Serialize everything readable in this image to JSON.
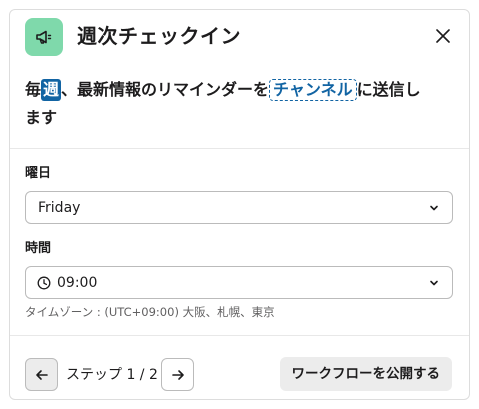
{
  "dialog": {
    "title": "週次チェックイン",
    "summary": {
      "part1": "毎",
      "week_token": "週",
      "part2": "、最新情報のリマインダーを",
      "channel_token": "チャンネル",
      "part3": "に送信し",
      "part4": "ます"
    }
  },
  "form": {
    "day_label": "曜日",
    "day_value": "Friday",
    "time_label": "時間",
    "time_value": "09:00",
    "timezone_note": "タイムゾーン : (UTC+09:00) 大阪、札幌、東京"
  },
  "footer": {
    "step_text": "ステップ 1 / 2",
    "publish_label": "ワークフローを公開する"
  },
  "colors": {
    "app_icon_bg": "#7fd9ab",
    "accent_blue": "#1264a3",
    "publish_bg": "#ececec"
  },
  "icons": {
    "app": "megaphone-icon",
    "close": "close-icon",
    "chevron": "chevron-down-icon",
    "clock": "clock-icon",
    "back": "arrow-left-icon",
    "next": "arrow-right-icon"
  }
}
